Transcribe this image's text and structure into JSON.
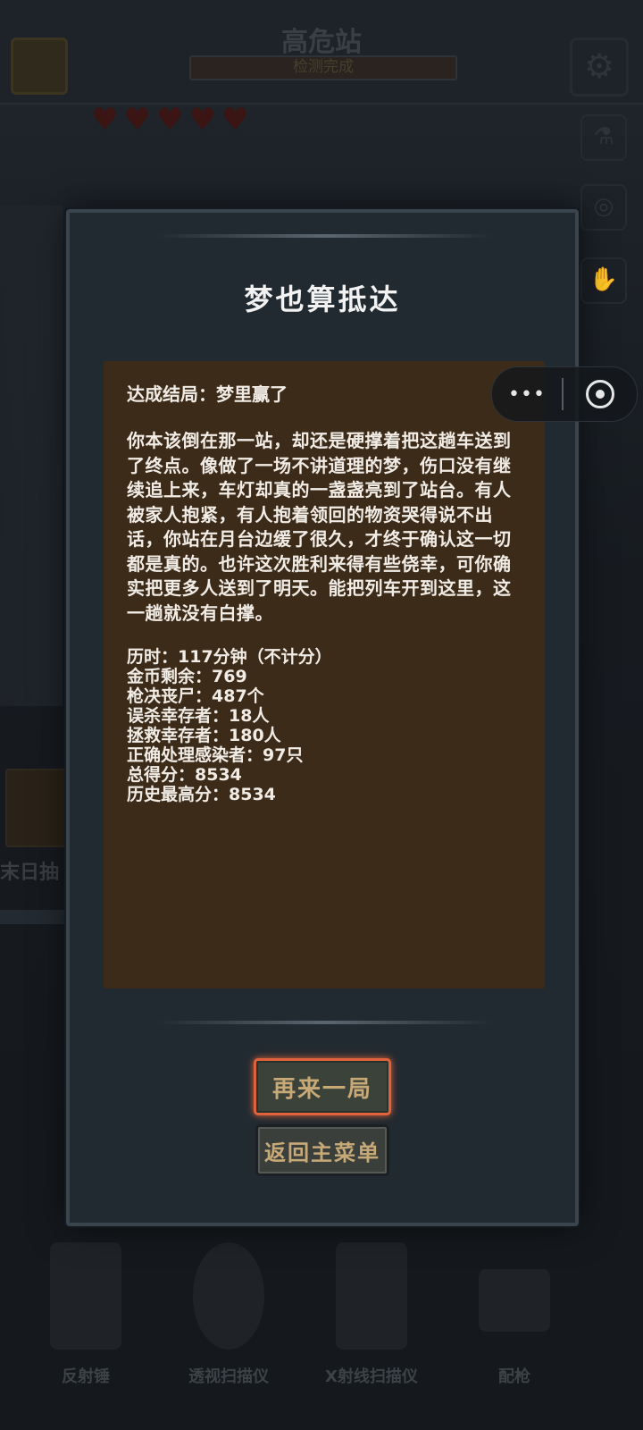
{
  "background": {
    "station_title": "高危站",
    "status_text": "检测完成",
    "hearts": 5,
    "side_label": "末日抽",
    "tools": [
      {
        "label": "反射锤",
        "icon": "hammer-icon"
      },
      {
        "label": "透视扫描仪",
        "icon": "magnifier-icon"
      },
      {
        "label": "X射线扫描仪",
        "icon": "xray-frame-icon"
      },
      {
        "label": "配枪",
        "icon": "pistol-icon"
      }
    ]
  },
  "dialog": {
    "title": "梦也算抵达",
    "ending_line": "达成结局：梦里赢了",
    "story": "你本该倒在那一站，却还是硬撑着把这趟车送到了终点。像做了一场不讲道理的梦，伤口没有继续追上来，车灯却真的一盏盏亮到了站台。有人被家人抱紧，有人抱着领回的物资哭得说不出话，你站在月台边缓了很久，才终于确认这一切都是真的。也许这次胜利来得有些侥幸，可你确实把更多人送到了明天。能把列车开到这里，这一趟就没有白撑。",
    "stats": [
      "历时：117分钟（不计分）",
      "金币剩余：769",
      "枪决丧尸：487个",
      "误杀幸存者：18人",
      "拯救幸存者：180人",
      "正确处理感染者：97只",
      "总得分：8534",
      "历史最高分：8534"
    ],
    "restart_label": "再来一局",
    "menu_label": "返回主菜单"
  },
  "capsule": {
    "more_glyph": "•••",
    "close_icon": "target-close-icon"
  },
  "colors": {
    "dialog_bg": "#222a31",
    "textbox_bg": "#3d2b1a",
    "button_text": "#c7a978",
    "restart_glow": "#e0623a"
  }
}
